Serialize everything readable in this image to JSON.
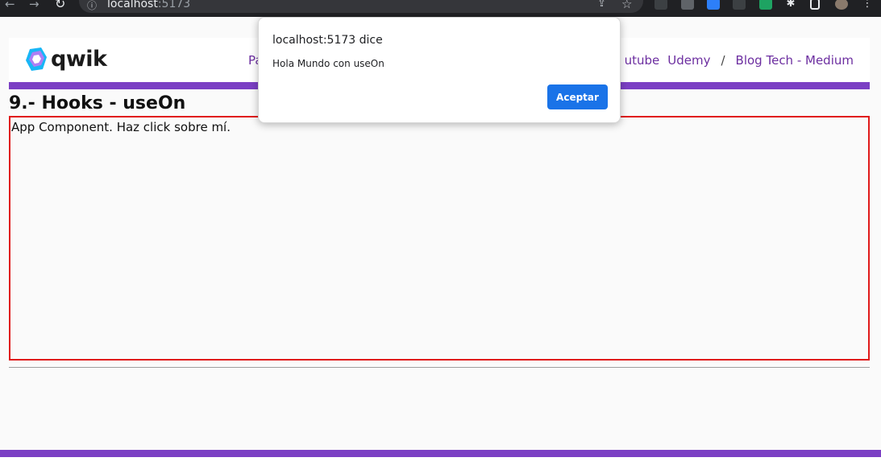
{
  "browser": {
    "url_host": "localhost",
    "url_port": ":5173"
  },
  "header": {
    "logo_text": "qwik",
    "nav_left_partial": "Pa",
    "nav_links": [
      "utube",
      "Udemy",
      "Blog Tech - Medium"
    ],
    "nav_separator": "/"
  },
  "page": {
    "title": "9.- Hooks - useOn",
    "app_text": "App Component. Haz click sobre mí."
  },
  "dialog": {
    "title": "localhost:5173 dice",
    "message": "Hola Mundo con useOn",
    "button_label": "Aceptar"
  },
  "colors": {
    "accent_purple": "#7b3fc4",
    "link_purple": "#6c2ea0",
    "box_border_red": "#e01b1b",
    "dialog_button_blue": "#1a73e8"
  }
}
